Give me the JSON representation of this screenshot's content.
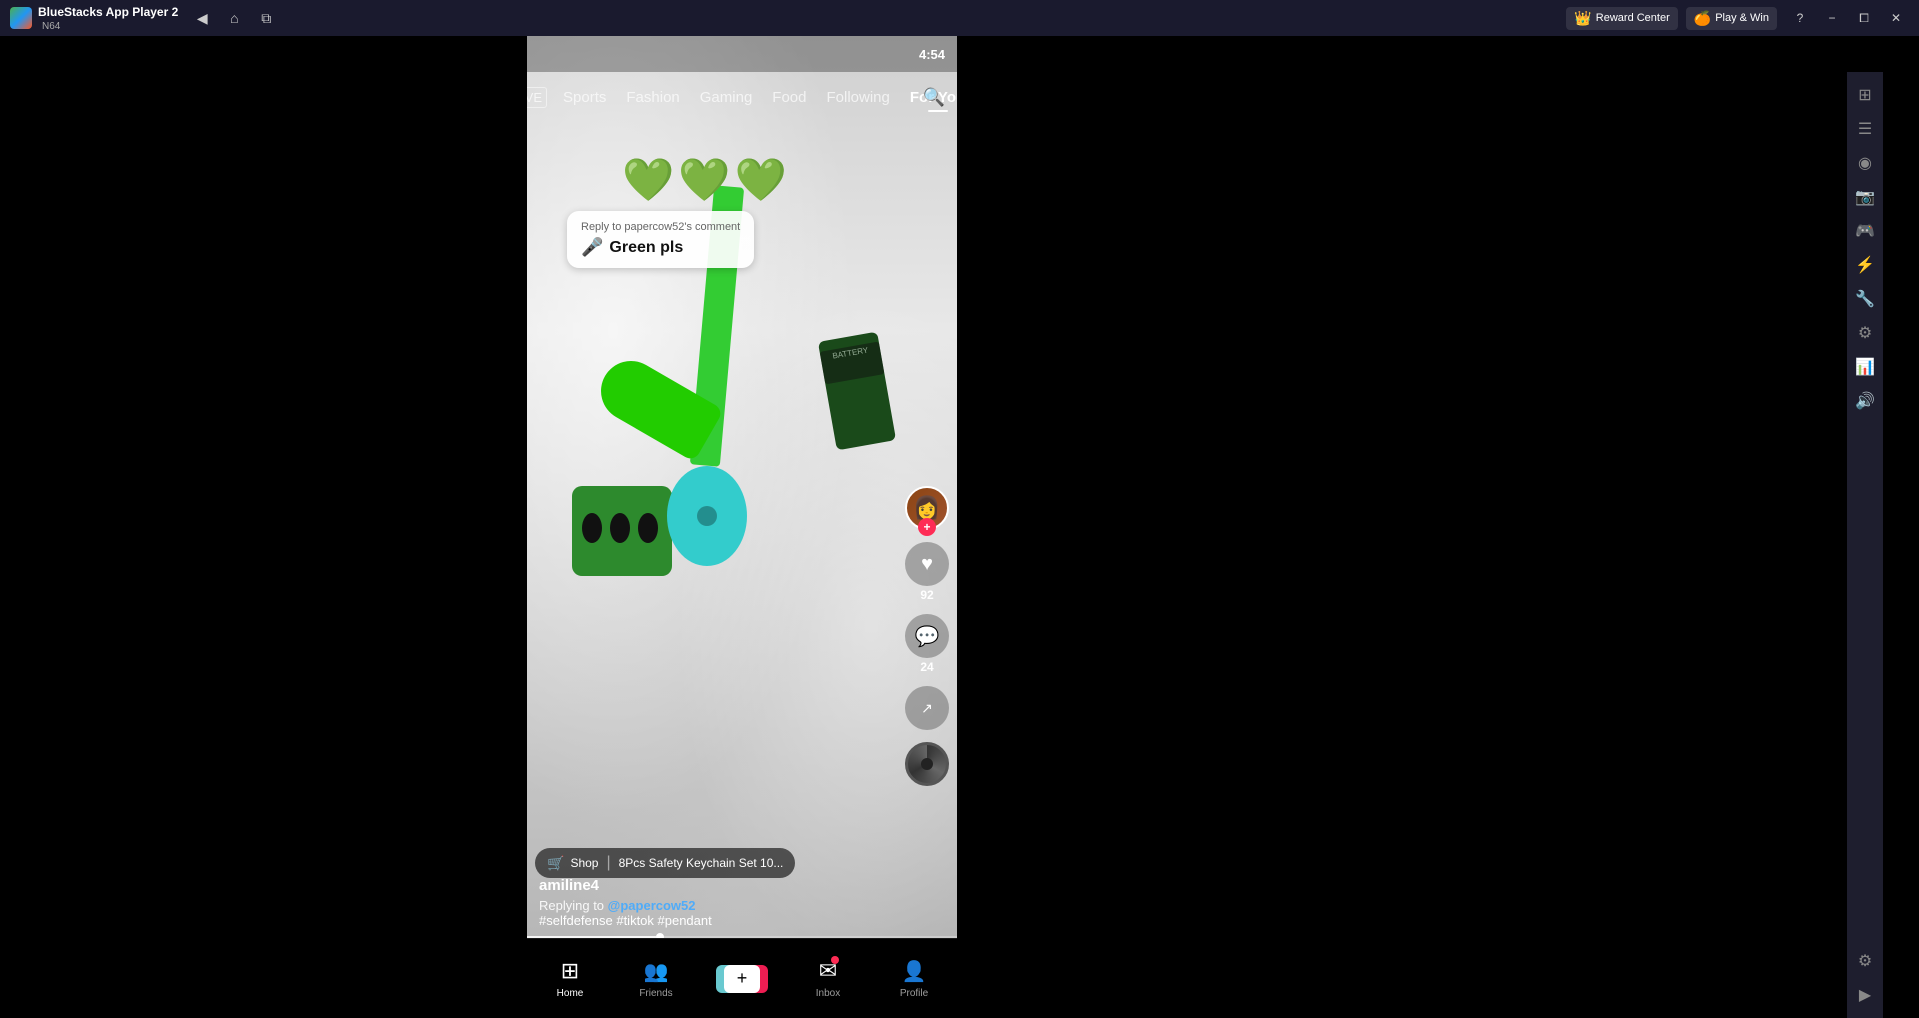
{
  "titlebar": {
    "app_name": "BlueStacks App Player 2",
    "subtitle": "N64",
    "logo_emoji": "🎮",
    "reward_label": "Reward Center",
    "win_label": "Play & Win",
    "nav": {
      "back": "‹",
      "home": "⌂",
      "overview": "⧉"
    },
    "actions": {
      "help": "?",
      "minimize": "−",
      "restore": "⧠",
      "close": "✕"
    }
  },
  "status_bar": {
    "time": "4:54"
  },
  "tiktok_nav": {
    "live_label": "LIVE",
    "items": [
      {
        "id": "sports",
        "label": "Sports",
        "active": false
      },
      {
        "id": "fashion",
        "label": "Fashion",
        "active": false
      },
      {
        "id": "gaming",
        "label": "Gaming",
        "active": false
      },
      {
        "id": "food",
        "label": "Food",
        "active": false
      },
      {
        "id": "following",
        "label": "Following",
        "active": false
      },
      {
        "id": "for-you",
        "label": "For You",
        "active": true
      }
    ],
    "search_icon": "🔍"
  },
  "video": {
    "emojis": "💚💚💚",
    "comment_reply": {
      "label": "Reply to papercow52's comment",
      "avatar_emoji": "🎤",
      "text": "Green pls"
    },
    "username": "amiline4",
    "replying_to": "Replying to",
    "reply_user": "@papercow52",
    "hashtags": "#selfdefense #tiktok #pendant",
    "shop": {
      "icon": "🛒",
      "label": "Shop",
      "divider": "|",
      "product": "8Pcs Safety Keychain Set 10..."
    }
  },
  "actions": {
    "like_count": "92",
    "comment_count": "24",
    "profile_emoji": "👤"
  },
  "bottom_nav": {
    "items": [
      {
        "id": "home",
        "icon": "⊞",
        "label": "Home",
        "active": true
      },
      {
        "id": "friends",
        "icon": "👥",
        "label": "Friends",
        "active": false
      },
      {
        "id": "add",
        "icon": "+",
        "label": "",
        "active": false
      },
      {
        "id": "inbox",
        "icon": "✉",
        "label": "Inbox",
        "active": false,
        "badge": true
      },
      {
        "id": "profile",
        "icon": "👤",
        "label": "Profile",
        "active": false
      }
    ]
  },
  "sidebar_icons": [
    "📱",
    "⚙",
    "🎮",
    "📸",
    "🎯",
    "📊",
    "🎨",
    "🖥",
    "⚡",
    "🔧",
    "📡",
    "🔊"
  ]
}
